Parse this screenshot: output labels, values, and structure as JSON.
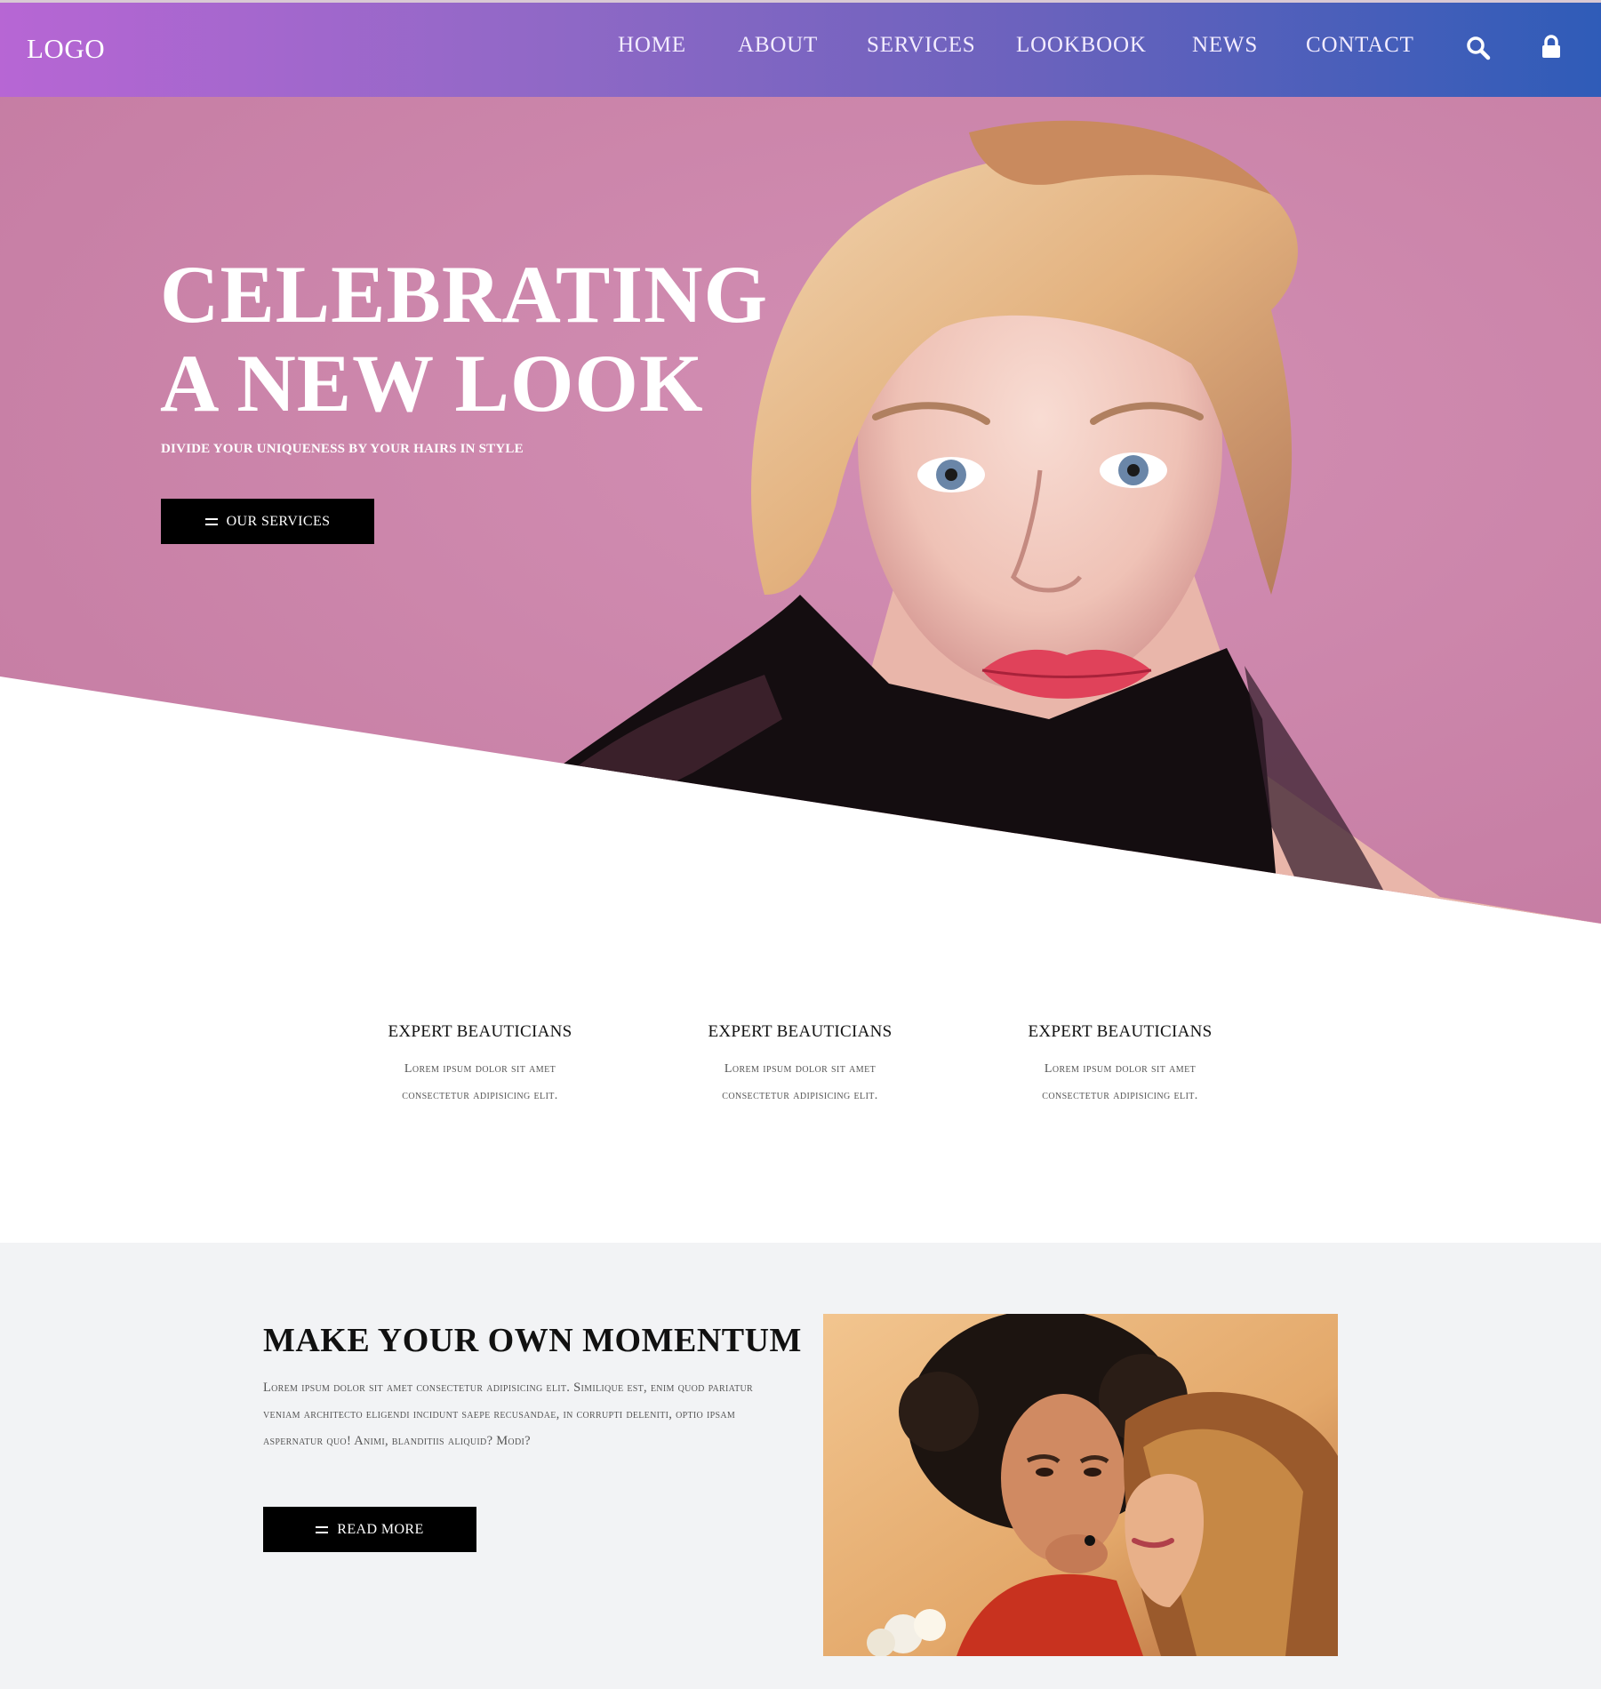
{
  "header": {
    "logo": "LOGO",
    "nav": [
      "HOME",
      "ABOUT",
      "SERVICES",
      "LOOKBOOK",
      "NEWS",
      "CONTACT"
    ],
    "icons": [
      "search-icon",
      "lock-icon"
    ]
  },
  "hero": {
    "title": "CELEBRATING\nA NEW LOOK",
    "subtitle": "DIVIDE YOUR UNIQUENESS BY YOUR HAIRS IN STYLE",
    "button": "OUR SERVICES"
  },
  "features": [
    {
      "title": "EXPERT BEAUTICIANS",
      "text": "Lorem ipsum dolor sit amet\nconsectetur adipisicing elit."
    },
    {
      "title": "EXPERT BEAUTICIANS",
      "text": "Lorem ipsum dolor sit amet\nconsectetur adipisicing elit."
    },
    {
      "title": "EXPERT BEAUTICIANS",
      "text": "Lorem ipsum dolor sit amet\nconsectetur adipisicing elit."
    }
  ],
  "momentum": {
    "title": "MAKE YOUR OWN MOMENTUM",
    "text": "Lorem ipsum dolor sit amet consectetur adipisicing elit. Similique est, enim quod pariatur veniam architecto eligendi incidunt saepe recusandae, in corrupti deleniti, optio ipsam aspernatur quo! Animi, blanditiis aliquid? Modi?",
    "button": "READ MORE"
  },
  "colors": {
    "header_gradient_start": "#b766d4",
    "header_gradient_end": "#2f5cb8",
    "hero_background": "#cc86ab",
    "button_bg": "#000000",
    "section_bg": "#f2f3f5"
  }
}
